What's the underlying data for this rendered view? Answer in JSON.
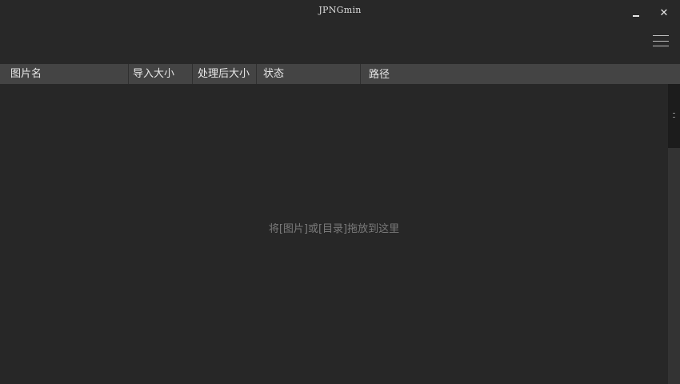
{
  "window": {
    "title": "JPNGmin",
    "minimize_icon": "minimize-icon",
    "close_icon": "close-icon",
    "close_glyph": "✕",
    "menu_icon": "hamburger-menu-icon"
  },
  "table": {
    "columns": [
      "图片名",
      "导入大小",
      "处理后大小",
      "状态",
      "路径"
    ],
    "empty_hint": "将[图片]或[目录]拖放到这里"
  },
  "colors": {
    "background": "#272727",
    "header": "#444444",
    "hint_text": "#7a7a7a"
  }
}
